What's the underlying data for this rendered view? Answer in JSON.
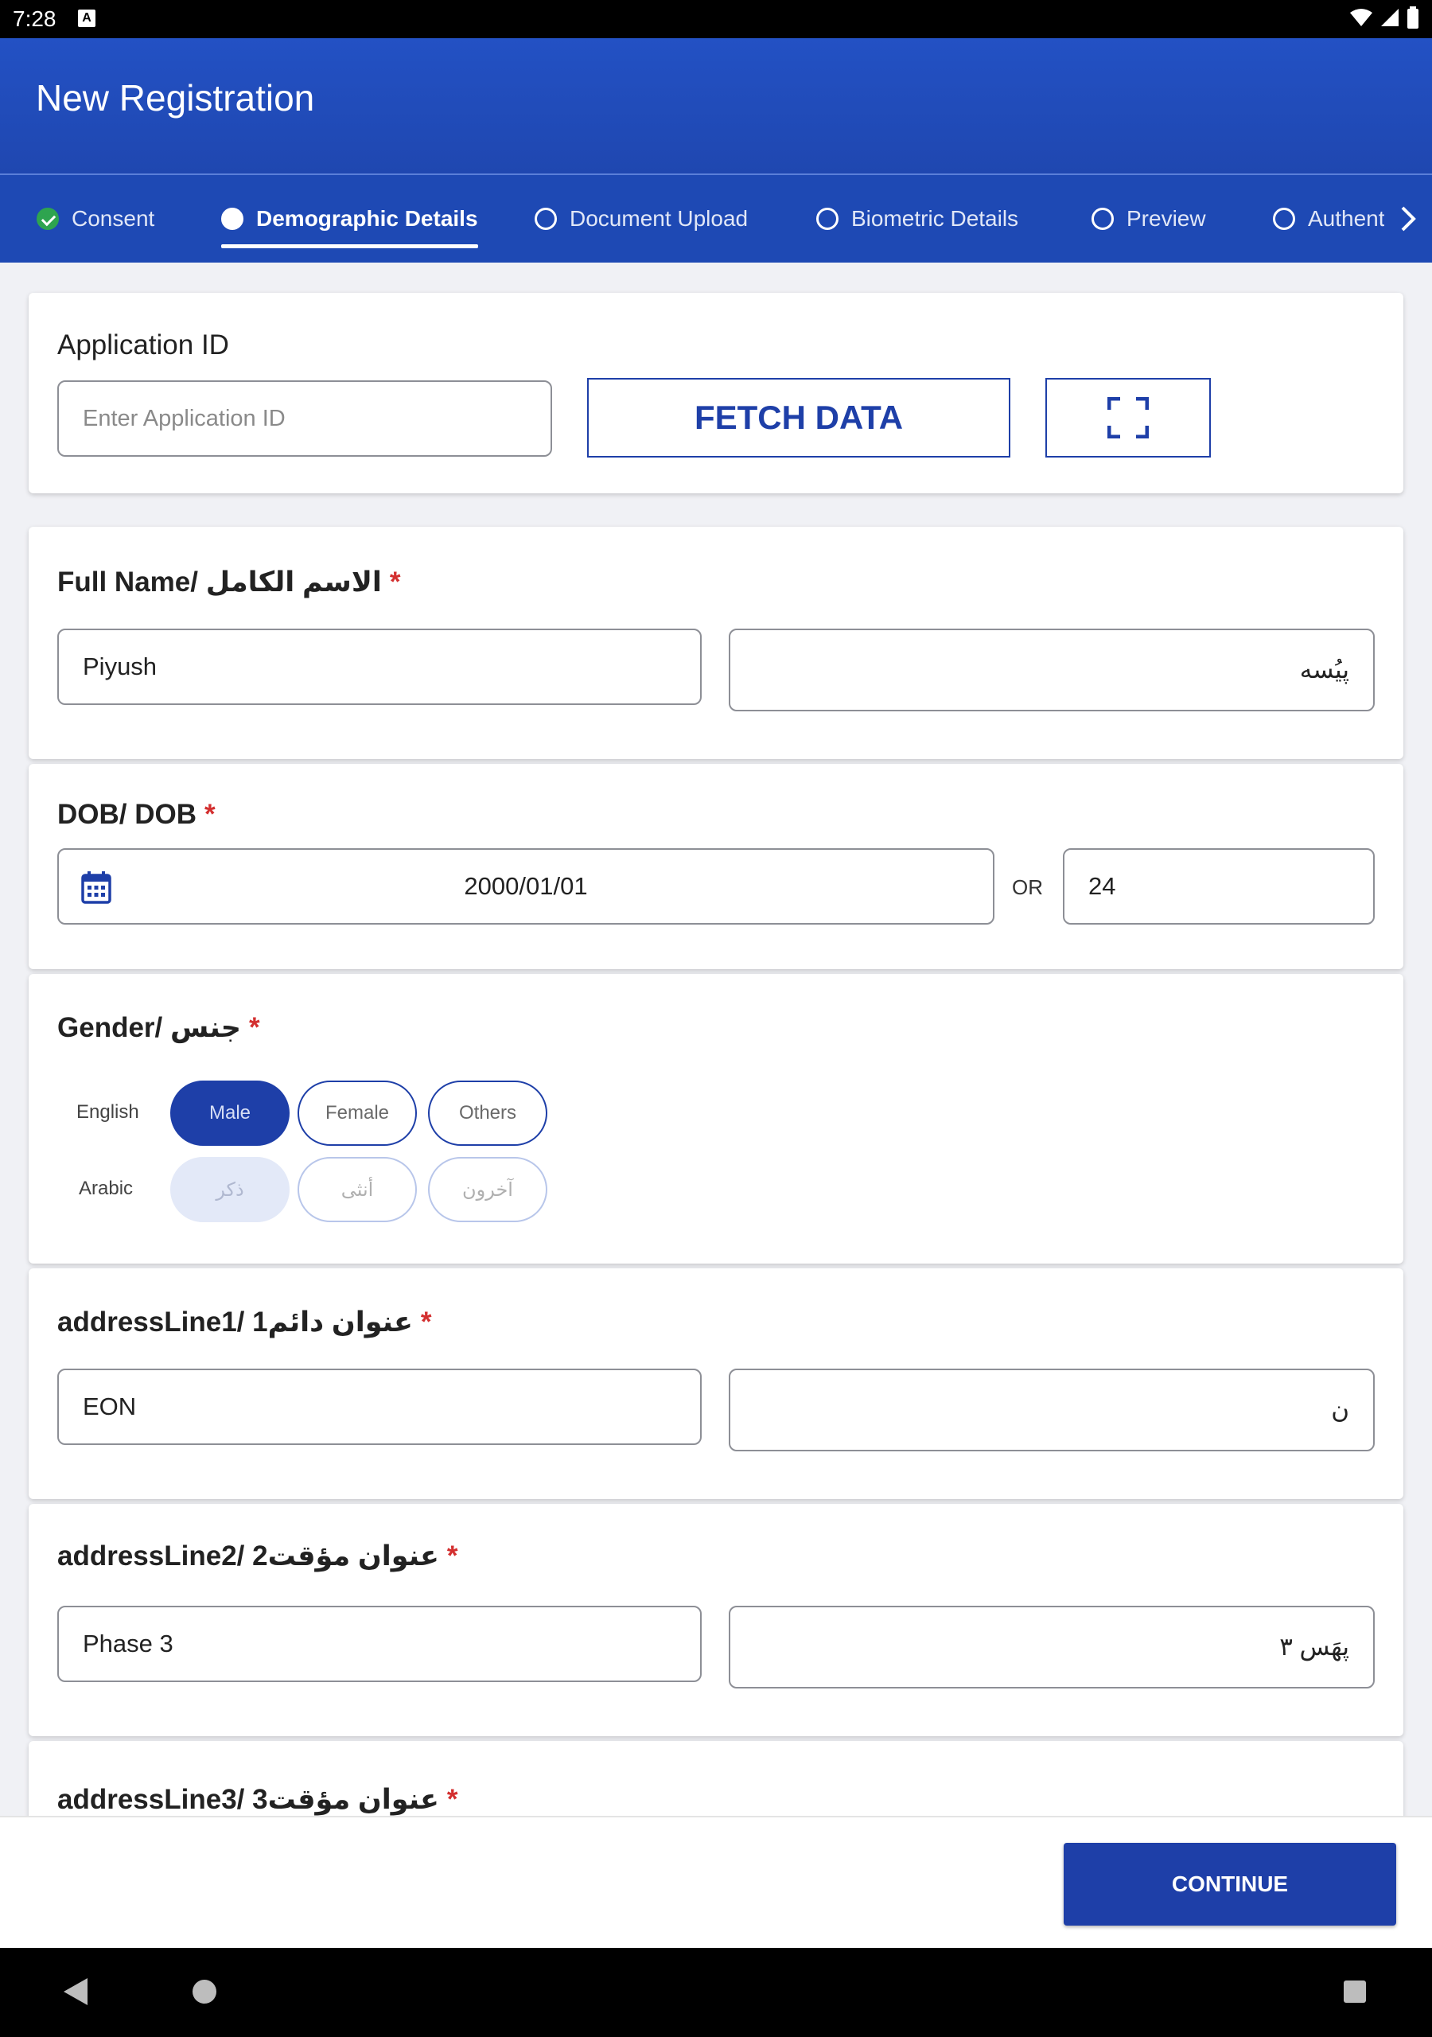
{
  "status_bar": {
    "time": "7:28"
  },
  "app_bar": {
    "title": "New Registration"
  },
  "tabs": [
    {
      "label": "Consent",
      "state": "done"
    },
    {
      "label": "Demographic Details",
      "state": "active"
    },
    {
      "label": "Document Upload",
      "state": "pending"
    },
    {
      "label": "Biometric Details",
      "state": "pending"
    },
    {
      "label": "Preview",
      "state": "pending"
    },
    {
      "label": "Authent",
      "state": "pending"
    }
  ],
  "application": {
    "label": "Application ID",
    "placeholder": "Enter Application ID",
    "fetch_label": "FETCH DATA",
    "scan_icon": "scan-icon"
  },
  "full_name": {
    "label": "Full Name/ الاسم الكامل",
    "required": "*",
    "value_en": "Piyush",
    "value_ar": "پیُسه"
  },
  "dob": {
    "label": "DOB/ DOB",
    "required": "*",
    "date_value": "2000/01/01",
    "or_label": "OR",
    "age_value": "24",
    "calendar_icon": "calendar-icon"
  },
  "gender": {
    "label": "Gender/ جنس",
    "required": "*",
    "english_label": "English",
    "arabic_label": "Arabic",
    "options_en": [
      "Male",
      "Female",
      "Others"
    ],
    "options_ar": [
      "ذكر",
      "أنثى",
      "آخرون"
    ],
    "selected_index": 0
  },
  "address_line1": {
    "label": "addressLine1/ عنوان دائم1",
    "required": "*",
    "value_en": "EON",
    "value_ar": "ن"
  },
  "address_line2": {
    "label": "addressLine2/ عنوان مؤقت2",
    "required": "*",
    "value_en": "Phase 3",
    "value_ar": "پهَس ٣"
  },
  "address_line3": {
    "label": "addressLine3/ عنوان مؤقت3",
    "required": "*"
  },
  "footer": {
    "continue_label": "CONTINUE"
  },
  "colors": {
    "primary": "#1e3fa8",
    "app_bar": "#2351c4",
    "required": "#d32f2f",
    "done": "#2ea44f"
  }
}
